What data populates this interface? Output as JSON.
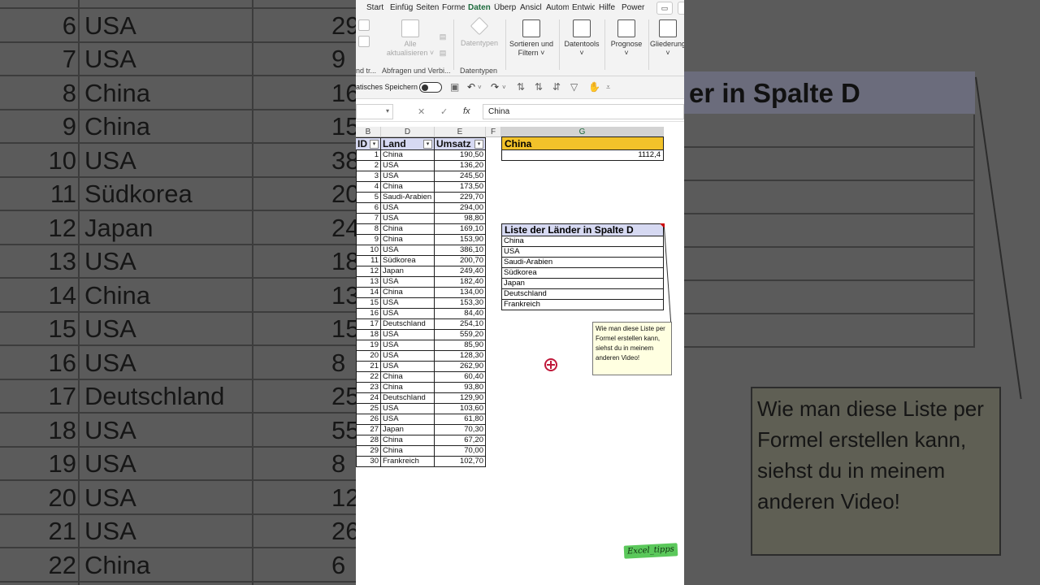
{
  "ribbon_tabs": [
    "Start",
    "Einfüg",
    "Seiten",
    "Formel",
    "Daten",
    "Überp",
    "Ansicl",
    "Autom",
    "Entwic",
    "Hilfe",
    "Power"
  ],
  "active_tab": "Daten",
  "ribbon": {
    "alle_aktualisieren": "Alle aktualisieren",
    "datentypen": "Datentypen",
    "sortieren_filtern": "Sortieren und Filtern",
    "datentools": "Datentools",
    "prognose": "Prognose",
    "gliederung": "Gliederung",
    "group_abfragen": "Abfragen und Verbi...",
    "group_datentypen": "Datentypen",
    "group_left": "nd tr..."
  },
  "qat": {
    "autosave_label": "atisches Speichern"
  },
  "formula_bar": {
    "value": "China",
    "fx": "fx"
  },
  "columns": [
    "B",
    "D",
    "E",
    "F",
    "G"
  ],
  "table": {
    "headers": [
      "ID",
      "Land",
      "Umsatz"
    ],
    "rows": [
      [
        "1",
        "China",
        "190,50"
      ],
      [
        "2",
        "USA",
        "136,20"
      ],
      [
        "3",
        "USA",
        "245,50"
      ],
      [
        "4",
        "China",
        "173,50"
      ],
      [
        "5",
        "Saudi-Arabien",
        "229,70"
      ],
      [
        "6",
        "USA",
        "294,00"
      ],
      [
        "7",
        "USA",
        "98,80"
      ],
      [
        "8",
        "China",
        "169,10"
      ],
      [
        "9",
        "China",
        "153,90"
      ],
      [
        "10",
        "USA",
        "386,10"
      ],
      [
        "11",
        "Südkorea",
        "200,70"
      ],
      [
        "12",
        "Japan",
        "249,40"
      ],
      [
        "13",
        "USA",
        "182,40"
      ],
      [
        "14",
        "China",
        "134,00"
      ],
      [
        "15",
        "USA",
        "153,30"
      ],
      [
        "16",
        "USA",
        "84,40"
      ],
      [
        "17",
        "Deutschland",
        "254,10"
      ],
      [
        "18",
        "USA",
        "559,20"
      ],
      [
        "19",
        "USA",
        "85,90"
      ],
      [
        "20",
        "USA",
        "128,30"
      ],
      [
        "21",
        "USA",
        "262,90"
      ],
      [
        "22",
        "China",
        "60,40"
      ],
      [
        "23",
        "China",
        "93,80"
      ],
      [
        "24",
        "Deutschland",
        "129,90"
      ],
      [
        "25",
        "USA",
        "103,60"
      ],
      [
        "26",
        "USA",
        "61,80"
      ],
      [
        "27",
        "Japan",
        "70,30"
      ],
      [
        "28",
        "China",
        "67,20"
      ],
      [
        "29",
        "China",
        "70,00"
      ],
      [
        "30",
        "Frankreich",
        "102,70"
      ]
    ]
  },
  "selected_country": {
    "name": "China",
    "sum": "1112,4"
  },
  "country_list": {
    "title": "Liste der Länder in Spalte D",
    "items": [
      "China",
      "USA",
      "Saudi-Arabien",
      "Südkorea",
      "Japan",
      "Deutschland",
      "Frankreich"
    ]
  },
  "comment": "Wie man diese Liste per Formel erstellen kann, siehst du in meinem anderen Video!",
  "watermark": "Excel_tipps",
  "background_zoom": {
    "rows": [
      {
        "id": "6",
        "land": "USA",
        "val": "29"
      },
      {
        "id": "7",
        "land": "USA",
        "val": "9"
      },
      {
        "id": "8",
        "land": "China",
        "val": "16"
      },
      {
        "id": "9",
        "land": "China",
        "val": "15"
      },
      {
        "id": "10",
        "land": "USA",
        "val": "38"
      },
      {
        "id": "11",
        "land": "Südkorea",
        "val": "20"
      },
      {
        "id": "12",
        "land": "Japan",
        "val": "24"
      },
      {
        "id": "13",
        "land": "USA",
        "val": "18"
      },
      {
        "id": "14",
        "land": "China",
        "val": "13"
      },
      {
        "id": "15",
        "land": "USA",
        "val": "15"
      },
      {
        "id": "16",
        "land": "USA",
        "val": "8"
      },
      {
        "id": "17",
        "land": "Deutschland",
        "val": "25"
      },
      {
        "id": "18",
        "land": "USA",
        "val": "55"
      },
      {
        "id": "19",
        "land": "USA",
        "val": "8"
      },
      {
        "id": "20",
        "land": "USA",
        "val": "12"
      },
      {
        "id": "21",
        "land": "USA",
        "val": "26"
      },
      {
        "id": "22",
        "land": "China",
        "val": "6"
      }
    ],
    "right_title": "er in Spalte D",
    "right_note": "Wie man diese Liste per Formel erstellen kann, siehst du in meinem anderen Video!"
  }
}
